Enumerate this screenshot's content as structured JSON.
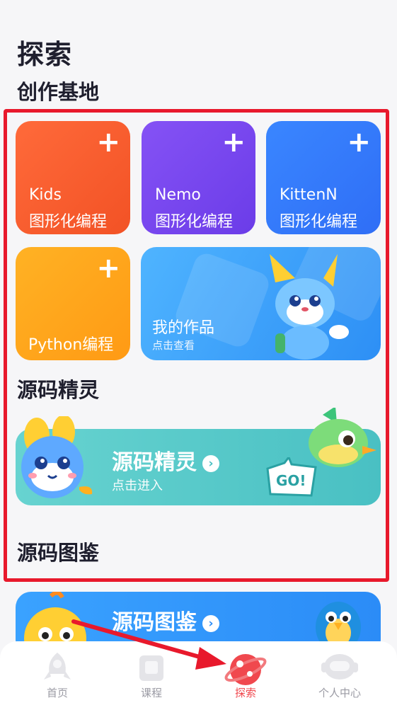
{
  "page": {
    "title": "探索"
  },
  "sections": {
    "creation": {
      "title": "创作基地"
    },
    "sprite": {
      "title": "源码精灵"
    },
    "guide": {
      "title": "源码图鉴"
    }
  },
  "tiles": [
    {
      "line1": "Kids",
      "line2": "图形化编程",
      "plus": "+"
    },
    {
      "line1": "Nemo",
      "line2": "图形化编程",
      "plus": "+"
    },
    {
      "line1": "KittenN",
      "line2": "图形化编程",
      "plus": "+"
    },
    {
      "line1": "Python编程",
      "plus": "+"
    }
  ],
  "works": {
    "title": "我的作品",
    "subtitle": "点击查看"
  },
  "sprite_banner": {
    "title": "源码精灵",
    "subtitle": "点击进入",
    "go": "GO!"
  },
  "guide_banner": {
    "title": "源码图鉴"
  },
  "tabbar": {
    "items": [
      {
        "label": "首页",
        "icon": "rocket-icon"
      },
      {
        "label": "课程",
        "icon": "book-icon"
      },
      {
        "label": "探索",
        "icon": "planet-icon",
        "active": true
      },
      {
        "label": "个人中心",
        "icon": "robot-icon"
      }
    ]
  },
  "colors": {
    "highlight": "#e8192c",
    "active_tab": "#f0484e",
    "kids": "#f25225",
    "nemo": "#6b3ce8",
    "kitten": "#2f6ef6",
    "python": "#ff9a14"
  }
}
